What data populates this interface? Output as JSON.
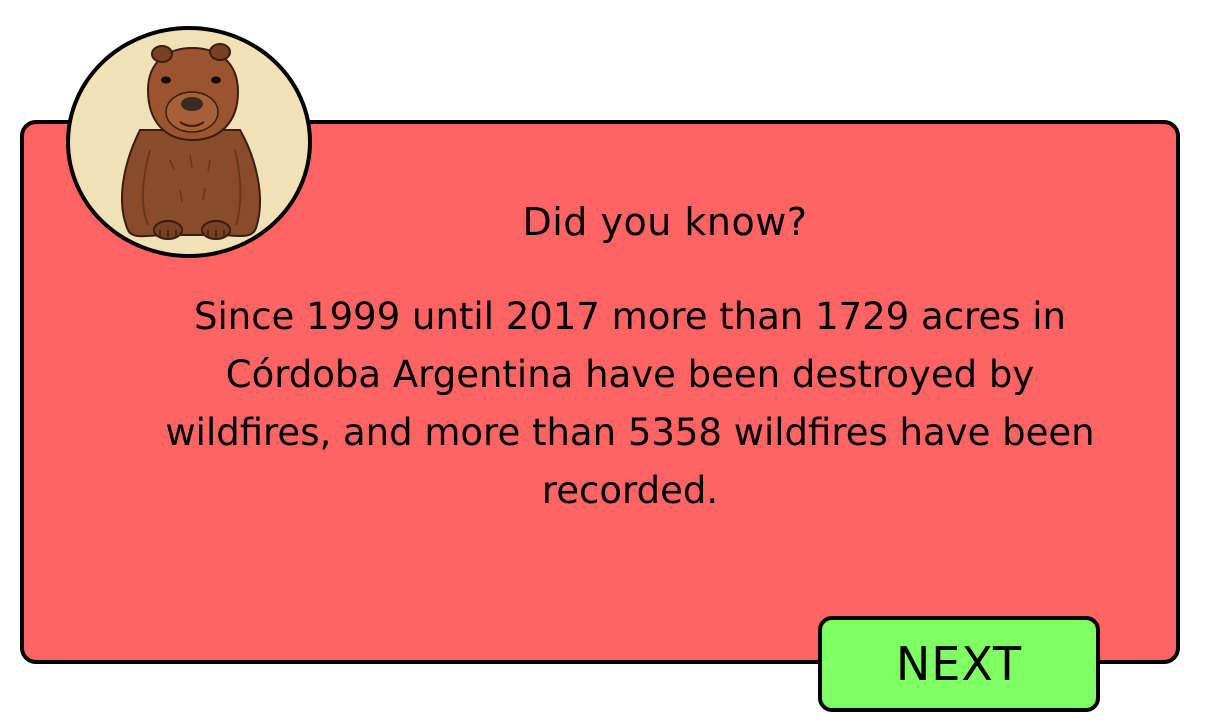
{
  "dialog": {
    "heading": "Did you know?",
    "body": "Since 1999 until 2017 more than 1729 acres in Córdoba Argentina have been destroyed by wildfires, and more than 5358 wildfires have been recorded.",
    "panel_color": "#ff6464"
  },
  "avatar": {
    "icon": "capybara-icon",
    "background_color": "#f0e2b6"
  },
  "next_button": {
    "label": "NEXT",
    "color": "#80ff64"
  }
}
